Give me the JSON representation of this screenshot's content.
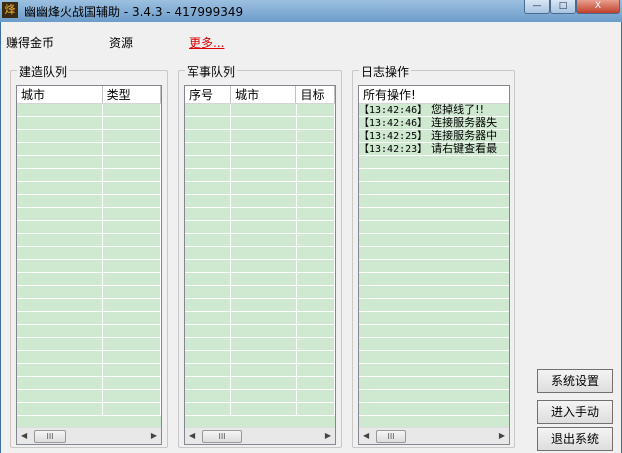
{
  "window": {
    "title": "幽幽烽火战国辅助 - 3.4.3 - 417999349",
    "icon_char": "烽",
    "minimize": "—",
    "maximize": "□",
    "close": "X"
  },
  "top": {
    "earn_gold": "赚得金币",
    "resources": "资源",
    "more": "更多..."
  },
  "build_queue": {
    "title": "建造队列",
    "columns": [
      "城市",
      "类型"
    ]
  },
  "military_queue": {
    "title": "军事队列",
    "columns": [
      "序号",
      "城市",
      "目标"
    ]
  },
  "log": {
    "title": "日志操作",
    "columns": [
      "所有操作!"
    ],
    "entries": [
      {
        "time": "【13:42:46】",
        "text": "您掉线了!!"
      },
      {
        "time": "【13:42:46】",
        "text": "连接服务器失"
      },
      {
        "time": "【13:42:25】",
        "text": "连接服务器中"
      },
      {
        "time": "【13:42:23】",
        "text": "请右键查看最"
      }
    ]
  },
  "buttons": {
    "settings": "系统设置",
    "manual": "进入手动",
    "exit": "退出系统"
  },
  "colors": {
    "list_bg": "#cfe8d0",
    "link": "#dd0000"
  }
}
